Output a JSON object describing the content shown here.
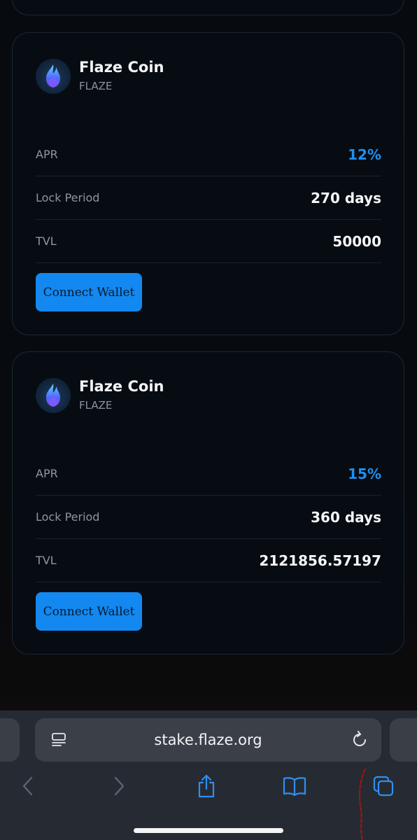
{
  "cards": [
    {
      "coin_name": "Flaze Coin",
      "coin_symbol": "FLAZE",
      "rows": [
        {
          "label": "APR",
          "value": "12%"
        },
        {
          "label": "Lock Period",
          "value": "270 days"
        },
        {
          "label": "TVL",
          "value": "50000"
        }
      ],
      "button_label": "Connect Wallet"
    },
    {
      "coin_name": "Flaze Coin",
      "coin_symbol": "FLAZE",
      "rows": [
        {
          "label": "APR",
          "value": "15%"
        },
        {
          "label": "Lock Period",
          "value": "360 days"
        },
        {
          "label": "TVL",
          "value": "2121856.57197"
        }
      ],
      "button_label": "Connect Wallet"
    }
  ],
  "browser": {
    "url": "stake.flaze.org",
    "icons": [
      "reader-mode-icon",
      "reload-icon",
      "back-icon",
      "forward-icon",
      "share-icon",
      "bookmarks-icon",
      "tabs-icon"
    ]
  },
  "colors": {
    "accent": "#1388f0",
    "apr": "#1f8ff0",
    "card_bg": "#070c12",
    "card_border": "#1d2733"
  }
}
